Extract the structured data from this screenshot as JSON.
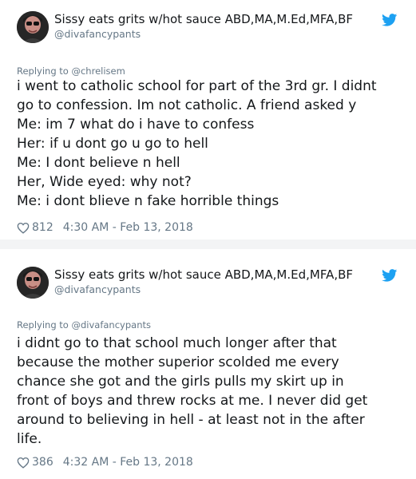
{
  "tweets": [
    {
      "author": {
        "name": "Sissy eats grits w/hot sauce ABD,MA,M.Ed,MFA,BF",
        "handle": "@divafancypants",
        "avatar_icon": "avatar-photo"
      },
      "reply_to": "Replying to @chrelisem",
      "body_lines": [
        "i went to catholic school for part of the 3rd gr. I didnt",
        "go to confession. Im not catholic. A friend asked y",
        "Me: im 7 what do i have to confess",
        "Her: if u dont go u go to hell",
        "Me: I dont believe n hell",
        "Her, Wide eyed: why not?",
        "Me: i dont blieve n fake horrible things"
      ],
      "likes": "812",
      "timestamp": "4:30 AM - Feb 13, 2018"
    },
    {
      "author": {
        "name": "Sissy eats grits w/hot sauce ABD,MA,M.Ed,MFA,BF",
        "handle": "@divafancypants",
        "avatar_icon": "avatar-photo"
      },
      "reply_to": "Replying to @divafancypants",
      "body_lines": [
        "i didnt go to that school much longer after that",
        "because the mother superior scolded me every",
        "chance she got and the girls pulls my skirt up in",
        "front of boys and threw rocks at me. I never did get",
        "around to believing in hell - at least not in the after",
        "life."
      ],
      "likes": "386",
      "timestamp": "4:32 AM - Feb 13, 2018"
    }
  ],
  "colors": {
    "text": "#14171a",
    "secondary": "#657786",
    "twitter_blue": "#1da1f2",
    "divider": "#f3f4f5"
  },
  "icons": {
    "brand": "twitter-bird-icon",
    "like": "heart-outline-icon"
  }
}
